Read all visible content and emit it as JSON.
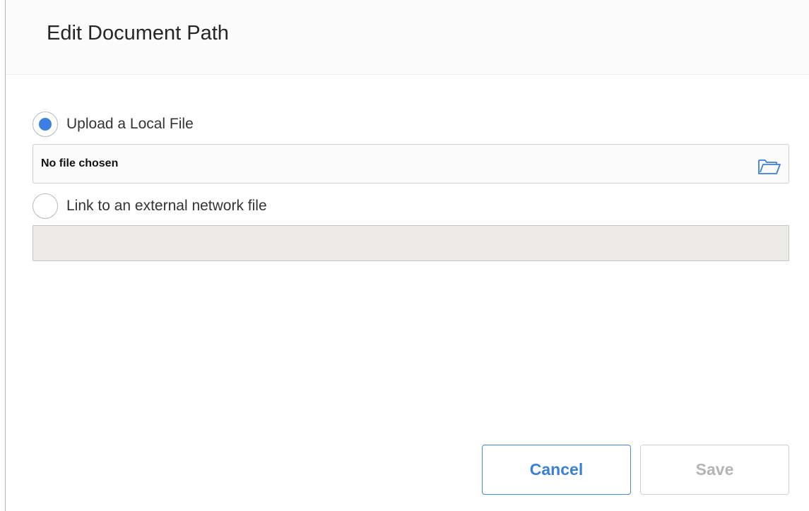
{
  "dialog": {
    "title": "Edit Document Path"
  },
  "options": {
    "local_file": {
      "label": "Upload a Local File",
      "selected": true,
      "file_text": "No file chosen",
      "browse_icon": "folder-open-icon"
    },
    "network_file": {
      "label": "Link to an external network file",
      "selected": false,
      "value": ""
    }
  },
  "buttons": {
    "cancel_label": "Cancel",
    "save_label": "Save"
  },
  "colors": {
    "accent": "#3b7fe0",
    "disabled_text": "#b4b4b4",
    "disabled_input_bg": "#ebeae6"
  }
}
